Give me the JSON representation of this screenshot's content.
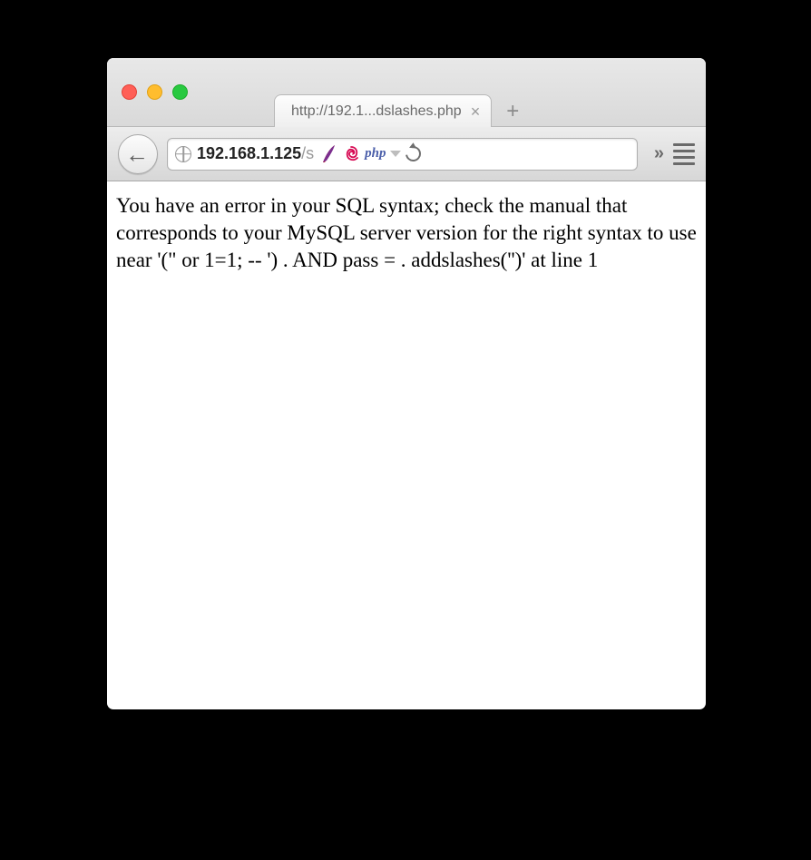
{
  "titlebar": {
    "tab_title": "http://192.1...dslashes.php",
    "tab_close": "×",
    "new_tab": "+"
  },
  "toolbar": {
    "back_arrow": "←",
    "url_host": "192.168.1.125",
    "url_path": "/s",
    "php_label": "php",
    "more": "»"
  },
  "page": {
    "error_text": "You have an error in your SQL syntax; check the manual that corresponds to your MySQL server version for the right syntax to use near '(\" or 1=1; -- ') . AND pass = . addslashes('')' at line 1"
  }
}
